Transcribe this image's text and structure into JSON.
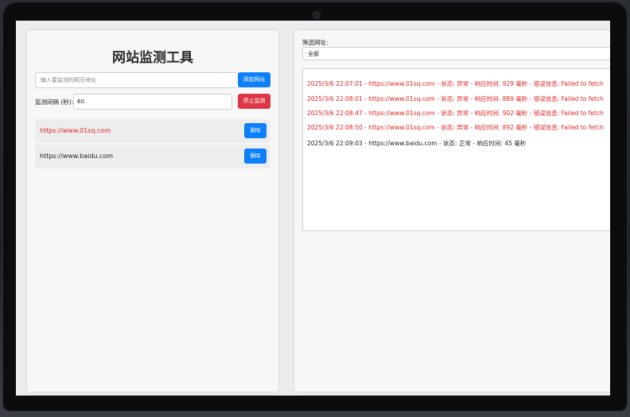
{
  "app": {
    "title": "网站监测工具"
  },
  "controls": {
    "url_placeholder": "输入要监测的网页地址",
    "add_label": "添加网址",
    "interval_label": "监测间隔 (秒):",
    "interval_value": "60",
    "stop_label": "停止监测"
  },
  "sites": [
    {
      "url": "https://www.01sq.com",
      "delete_label": "删除",
      "status": "error"
    },
    {
      "url": "https://www.baidu.com",
      "delete_label": "删除",
      "status": "normal"
    }
  ],
  "filter": {
    "label": "筛选网址:",
    "selected": "全部"
  },
  "logs": [
    {
      "text": "2025/3/6 22:07:01 - https://www.01sq.com - 状态: 异常 - 响应时间: 929 毫秒 - 错误信息: Failed to fetch",
      "status": "error"
    },
    {
      "text": "2025/3/6 22:08:01 - https://www.01sq.com - 状态: 异常 - 响应时间: 889 毫秒 - 错误信息: Failed to fetch",
      "status": "error"
    },
    {
      "text": "2025/3/6 22:08:47 - https://www.01sq.com - 状态: 异常 - 响应时间: 902 毫秒 - 错误信息: Failed to fetch",
      "status": "error"
    },
    {
      "text": "2025/3/6 22:08:50 - https://www.01sq.com - 状态: 异常 - 响应时间: 892 毫秒 - 错误信息: Failed to fetch",
      "status": "error"
    },
    {
      "text": "2025/3/6 22:09:03 - https://www.baidu.com - 状态: 正常 - 响应时间: 45 毫秒",
      "status": "normal"
    }
  ],
  "colors": {
    "error": "#e02424",
    "normal": "#222222",
    "primary": "#0d7ff8",
    "danger": "#dc3545"
  }
}
